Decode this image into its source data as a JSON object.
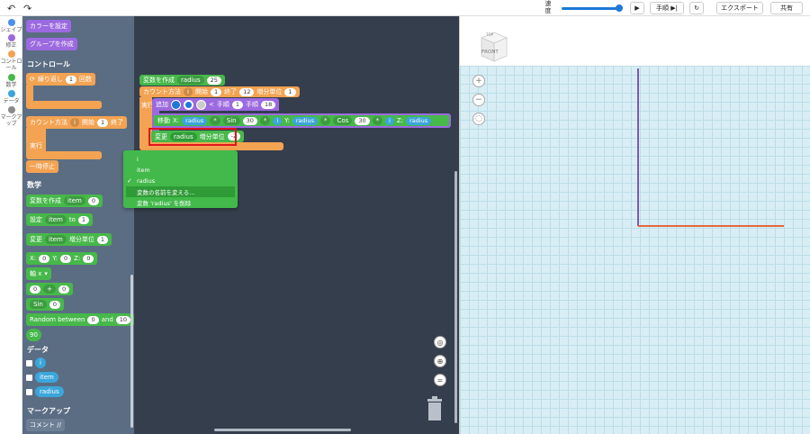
{
  "toolbar": {
    "speed_label": "速度",
    "step_label": "手順",
    "export_label": "エクスポート",
    "share_label": "共有"
  },
  "categories": [
    {
      "label": "シェイプ",
      "color": "#4a8fe8"
    },
    {
      "label": "修正",
      "color": "#9b69e0"
    },
    {
      "label": "コントロール",
      "color": "#f3a352"
    },
    {
      "label": "数学",
      "color": "#47b84a"
    },
    {
      "label": "データ",
      "color": "#3ba6d9"
    },
    {
      "label": "マークアップ",
      "color": "#8a8a8a"
    }
  ],
  "flyout": {
    "set_color": "カラーを設定",
    "create_group": "グループを作成",
    "control_title": "コントロール",
    "repeat": "繰り返し",
    "repeat_count": "1",
    "repeat_unit": "回数",
    "count_with": "カウント方法",
    "count_var": "i",
    "count_start_label": "開始",
    "count_start": "1",
    "count_end_label": "終了",
    "run_label": "実行",
    "pause": "一時停止",
    "math_title": "数学",
    "create_var": "変数を作成",
    "var_item": "item",
    "var_value": "0",
    "set_label": "設定",
    "to_label": "to",
    "set_value": "1",
    "change_label": "変更",
    "change_unit": "増分単位",
    "change_value": "1",
    "x_label": "X:",
    "y_label": "Y:",
    "z_label": "Z:",
    "x_val": "0",
    "y_val": "0",
    "z_val": "0",
    "axis_label": "軸 x",
    "op_left": "0",
    "op": "+",
    "op_right": "0",
    "sin_label": "Sin",
    "sin_val": "0",
    "random_label": "Random between",
    "random_min": "0",
    "random_and": "and",
    "random_max": "10",
    "ninety": "90",
    "data_title": "データ",
    "var_i": "i",
    "var_item_pill": "item",
    "var_radius": "radius",
    "markup_title": "マークアップ",
    "comment": "コメント //"
  },
  "workspace": {
    "create_var": "変数を作成",
    "var_radius": "radius",
    "var_radius_value": "25",
    "count_with": "カウント方法",
    "count_var": "i",
    "start_label": "開始",
    "start_val": "1",
    "end_label": "終了",
    "end_val": "12",
    "step_unit": "増分単位",
    "step_val": "1",
    "run_label": "実行",
    "add_label": "追加",
    "hand_label": "手順",
    "hand_val": "1",
    "hand_label2": "手順",
    "hand_val2": "18",
    "move_label": "移動",
    "x_label": "X:",
    "y_label": "Y:",
    "z_label": "Z:",
    "mul": "*",
    "sin_label": "Sin",
    "cos_label": "Cos",
    "angle_a": "30",
    "angle_b": "30",
    "change_label": "変更",
    "change_var": "radius",
    "change_unit": "増分単位",
    "change_val": "-2"
  },
  "context_menu": {
    "items": [
      "i",
      "item",
      "radius",
      "変数の名前を変える...",
      "変数 'radius' を削除"
    ],
    "checked_index": 2,
    "highlight_index": 3
  },
  "view3d": {
    "cube_label": "FRONT",
    "cube_top_label": "TOP"
  }
}
